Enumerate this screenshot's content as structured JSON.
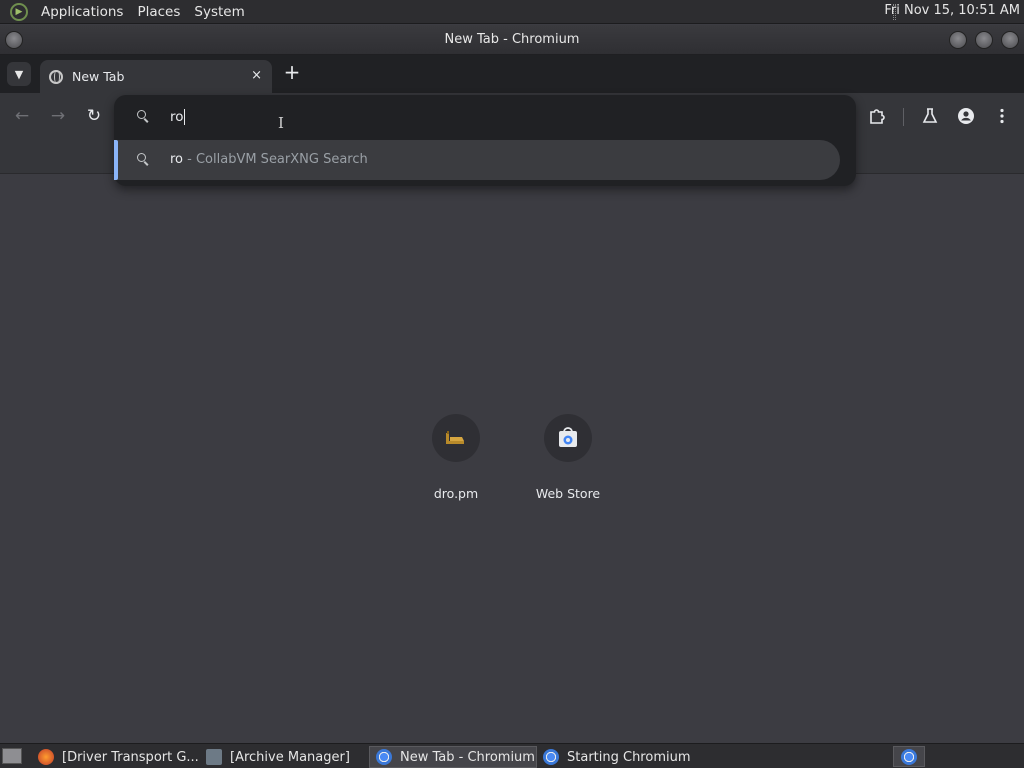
{
  "top_panel": {
    "menus": [
      "Applications",
      "Places",
      "System"
    ],
    "clock": "Fri Nov 15, 10:51 AM"
  },
  "window": {
    "title": "New Tab - Chromium"
  },
  "tabs": [
    {
      "label": "New Tab",
      "close": "×"
    }
  ],
  "tabstrip": {
    "new_tab": "+"
  },
  "toolbar": {
    "back": "←",
    "forward": "→",
    "reload": "↻"
  },
  "omnibox": {
    "value": "ro",
    "ibeam": "I",
    "suggestion": {
      "query": "ro",
      "description": " - CollabVM SearXNG Search"
    }
  },
  "shortcuts": [
    {
      "name": "dro.pm"
    },
    {
      "name": "Web Store"
    }
  ],
  "taskbar": {
    "items": [
      {
        "label": "[Driver Transport G...",
        "active": false
      },
      {
        "label": "[Archive Manager]",
        "active": false
      },
      {
        "label": "New Tab - Chromium",
        "active": true
      },
      {
        "label": "Starting Chromium",
        "active": false
      }
    ]
  },
  "colors": {
    "accent": "#8ab4f8",
    "page_bg": "#3c3c42",
    "omnibox_bg": "#202124"
  }
}
